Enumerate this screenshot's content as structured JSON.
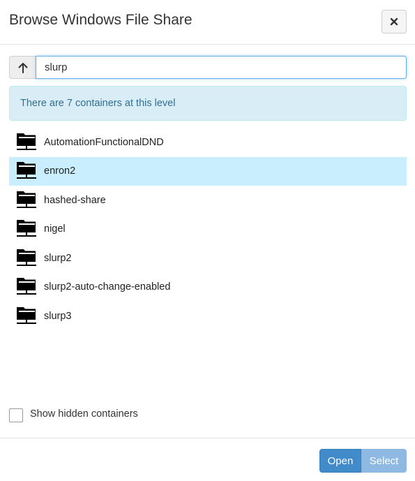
{
  "dialog": {
    "title": "Browse Windows File Share",
    "close_icon": "close-icon"
  },
  "path": {
    "up_icon": "arrow-up-icon",
    "value": "slurp"
  },
  "info": {
    "message": "There are 7 containers at this level"
  },
  "containers": {
    "icon": "network-folder-icon",
    "selected_index": 1,
    "items": [
      {
        "label": "AutomationFunctionalDND"
      },
      {
        "label": "enron2"
      },
      {
        "label": "hashed-share"
      },
      {
        "label": "nigel"
      },
      {
        "label": "slurp2"
      },
      {
        "label": "slurp2-auto-change-enabled"
      },
      {
        "label": "slurp3"
      }
    ]
  },
  "options": {
    "show_hidden_label": "Show hidden containers",
    "show_hidden_checked": false
  },
  "footer": {
    "open_label": "Open",
    "select_label": "Select"
  },
  "colors": {
    "info_bg": "#d9edf7",
    "info_text": "#31708f",
    "selected_row": "#c9efff",
    "primary": "#428bca",
    "primary_disabled": "#8eb9e2"
  }
}
